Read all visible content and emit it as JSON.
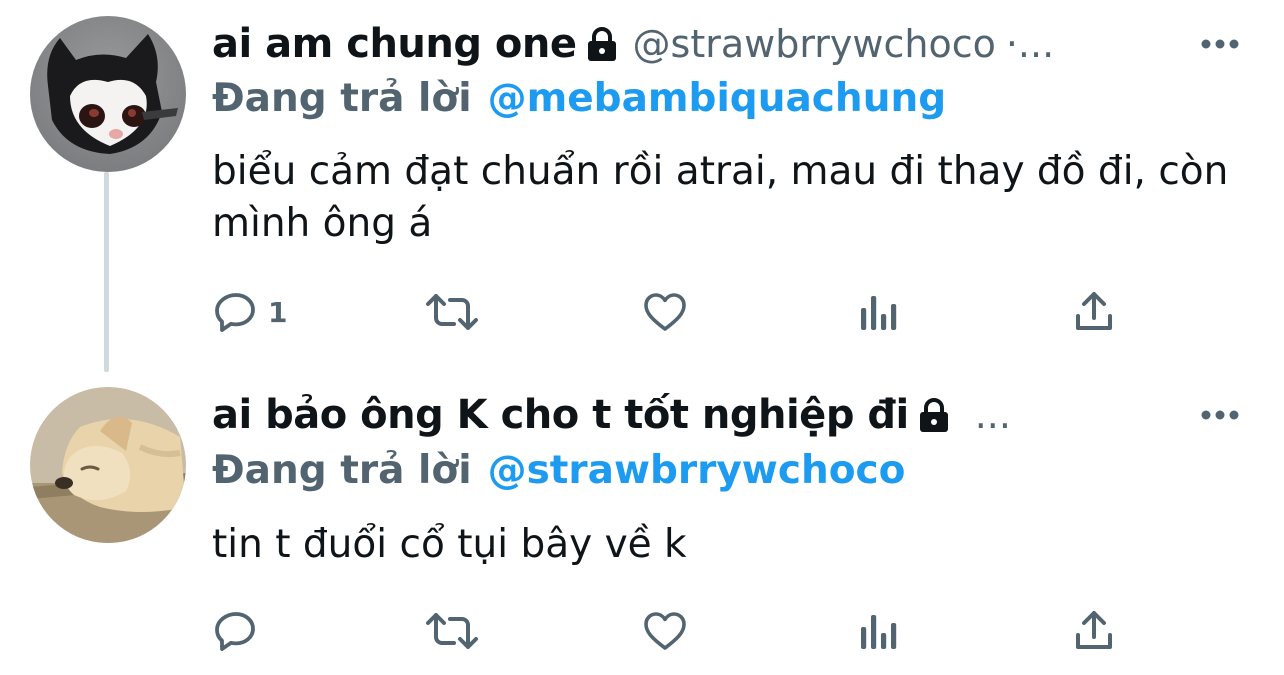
{
  "colors": {
    "text_primary": "#0f1419",
    "text_secondary": "#536471",
    "link": "#1d9bf0",
    "thread_line": "#cfd9de"
  },
  "tweets": [
    {
      "display_name": "ai am chung one",
      "protected_icon": "lock-icon",
      "handle": "@strawbrrywchoco",
      "separator": "·...",
      "reply_prefix": "Đang trả lời",
      "reply_to": "@mebambiquachung",
      "text": "biểu cảm đạt chuẩn rồi atrai, mau đi thay đồ đi, còn mình ông á",
      "reply_count": "1",
      "avatar": "cat-avatar"
    },
    {
      "display_name": "ai bảo ông K cho t tốt nghiệp đi",
      "protected_icon": "lock-icon",
      "handle": "",
      "separator": "...",
      "reply_prefix": "Đang trả lời",
      "reply_to": "@strawbrrywchoco",
      "text": "tin t đuổi cổ tụi bây về k",
      "reply_count": "",
      "avatar": "dog-avatar"
    }
  ]
}
